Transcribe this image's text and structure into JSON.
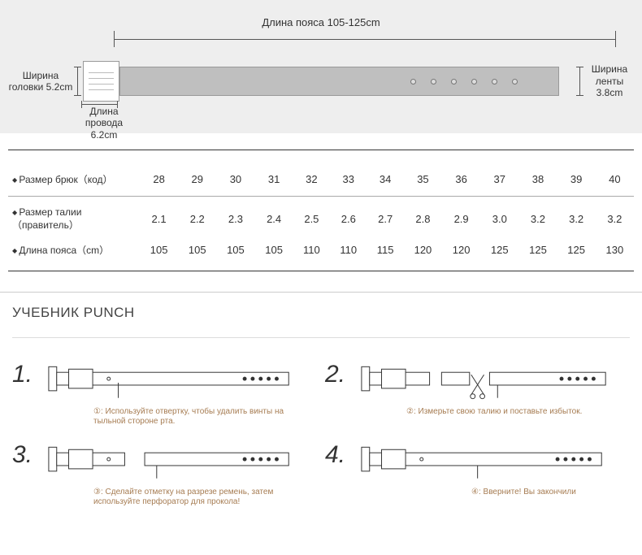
{
  "diagram": {
    "length_label": "Длина пояса  105-125cm",
    "head_width_label": "Ширина головки 5.2cm",
    "strap_width_label": "Ширина ленты 3.8cm",
    "wire_length_label": "Длина провода 6.2cm"
  },
  "table": {
    "rows": [
      {
        "label": "Размер брюк（код）",
        "values": [
          "28",
          "29",
          "30",
          "31",
          "32",
          "33",
          "34",
          "35",
          "36",
          "37",
          "38",
          "39",
          "40"
        ]
      },
      {
        "label": "Размер   талии（правитель）",
        "values": [
          "2.1",
          "2.2",
          "2.3",
          "2.4",
          "2.5",
          "2.6",
          "2.7",
          "2.8",
          "2.9",
          "3.0",
          "3.2",
          "3.2",
          "3.2"
        ]
      },
      {
        "label": "Длина пояса（cm）",
        "values": [
          "105",
          "105",
          "105",
          "105",
          "110",
          "110",
          "115",
          "120",
          "120",
          "125",
          "125",
          "125",
          "130"
        ]
      }
    ]
  },
  "tutorial": {
    "title": "УЧЕБНИК PUNCH",
    "steps": [
      {
        "num": "1.",
        "caption": "①: Используйте отвертку, чтобы удалить винты на тыльной стороне рта."
      },
      {
        "num": "2.",
        "caption": "②: Измерьте свою талию и поставьте избыток."
      },
      {
        "num": "3.",
        "caption": "③: Сделайте отметку на разрезе ремень, затем используйте перфоратор для прокола!"
      },
      {
        "num": "4.",
        "caption": "④: Вверните! Вы закончили"
      }
    ]
  }
}
